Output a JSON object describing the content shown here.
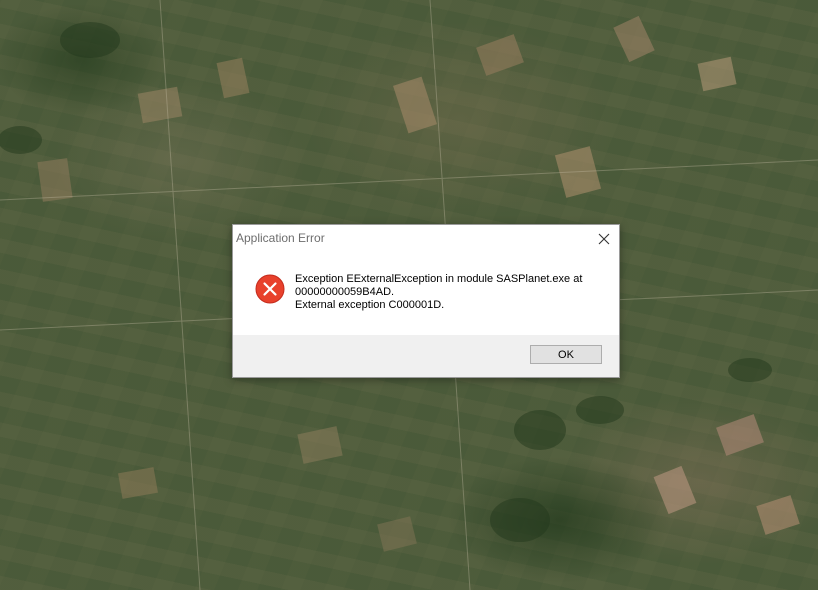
{
  "background": {
    "description_icon": "satellite-map-background"
  },
  "dialog": {
    "title": "Application Error",
    "icons": {
      "close": "close-icon",
      "error": "error-icon"
    },
    "colors": {
      "error_red": "#e8412c",
      "footer_bg": "#f0f0f0",
      "button_bg": "#e1e1e1"
    },
    "message": {
      "line1": "Exception EExternalException in module SASPlanet.exe at",
      "line2": "00000000059B4AD.",
      "line3": "External exception C000001D."
    },
    "ok_label": "OK"
  }
}
